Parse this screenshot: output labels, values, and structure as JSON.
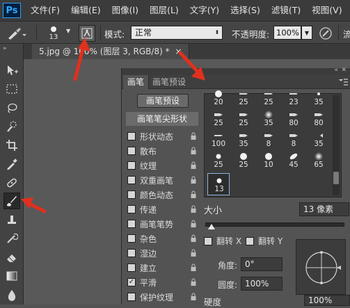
{
  "app": {
    "logo": "Ps"
  },
  "menu": [
    "文件(F)",
    "编辑(E)",
    "图像(I)",
    "图层(L)",
    "文字(Y)",
    "选择(S)",
    "滤镜(T)",
    "视图(V)"
  ],
  "options": {
    "brush_size": "13",
    "mode_label": "模式:",
    "mode_value": "正常",
    "opacity_label": "不透明度:",
    "opacity_value": "100%",
    "flow_label": "流"
  },
  "document_tab": {
    "title": "5.jpg @ 100% (图层 3, RGB/8) *",
    "close": "×"
  },
  "panel": {
    "tabs": [
      "画笔",
      "画笔预设"
    ],
    "preset_button": "画笔预设",
    "tip_shape_header": "画笔笔尖形状",
    "options": [
      {
        "label": "形状动态",
        "checked": false,
        "locked": true
      },
      {
        "label": "散布",
        "checked": false,
        "locked": true
      },
      {
        "label": "纹理",
        "checked": false,
        "locked": true
      },
      {
        "label": "双重画笔",
        "checked": false,
        "locked": true
      },
      {
        "label": "颜色动态",
        "checked": false,
        "locked": true
      },
      {
        "label": "传递",
        "checked": false,
        "locked": true
      },
      {
        "label": "画笔笔势",
        "checked": false,
        "locked": true
      },
      {
        "label": "杂色",
        "checked": false,
        "locked": true
      },
      {
        "label": "湿边",
        "checked": false,
        "locked": true
      },
      {
        "label": "建立",
        "checked": false,
        "locked": true
      },
      {
        "label": "平滑",
        "checked": true,
        "locked": true
      },
      {
        "label": "保护纹理",
        "checked": false,
        "locked": true
      }
    ],
    "brush_grid": [
      [
        "20",
        "25",
        "25",
        "23",
        "35"
      ],
      [
        "25",
        "25",
        "35",
        "80",
        "80"
      ],
      [
        "100",
        "35",
        "8",
        "8",
        "35"
      ],
      [
        "25",
        "25",
        "10",
        "45",
        "65"
      ],
      [
        "13"
      ]
    ],
    "size_label": "大小",
    "size_value": "13 像素",
    "flip_x_label": "翻转 X",
    "flip_y_label": "翻转 Y",
    "angle_label": "角度:",
    "angle_value": "0°",
    "roundness_label": "圆度:",
    "roundness_value": "100%",
    "hardness_label": "硬度",
    "hardness_value": "100%"
  },
  "colors": {
    "accent_arrow": "#e0301e",
    "panel_bg": "#535353",
    "toolbar_bg": "#434343"
  }
}
